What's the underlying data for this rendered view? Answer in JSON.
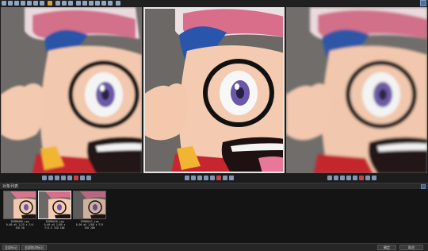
{
  "section": {
    "title": "对象列表"
  },
  "thumbnails": [
    {
      "filename": "IEDM0009.jpg",
      "line1": "0.00 eV 1/25 s F/4",
      "line2": "ISO 50"
    },
    {
      "filename": "IEDM0010.jpg",
      "line1": "0.00 eV 1/60 s",
      "line2": "F/4.5 ISO 100"
    },
    {
      "filename": "IEDM0011.jpg",
      "line1": "0.00 eV 1/80 s F/5",
      "line2": "ISO 200"
    }
  ],
  "footer": {
    "select_all": "全部标记",
    "deselect_all": "全部取消标记",
    "ok": "确定",
    "cancel": "取消"
  },
  "colors": {
    "accent": "#4a6fa5",
    "selection_border": "#e6e6e6"
  },
  "icons": {
    "toolbar": [
      "zoom-fit-icon",
      "zoom-in-icon",
      "zoom-out-icon",
      "zoom-100-icon",
      "warning-icon",
      "grid-icon",
      "compare-icon",
      "sync-icon",
      "info-icon"
    ],
    "pane_toolbar": [
      "fit-icon",
      "zoom-in-icon",
      "zoom-out-icon",
      "mark-icon",
      "delete-icon",
      "rotate-icon"
    ]
  }
}
